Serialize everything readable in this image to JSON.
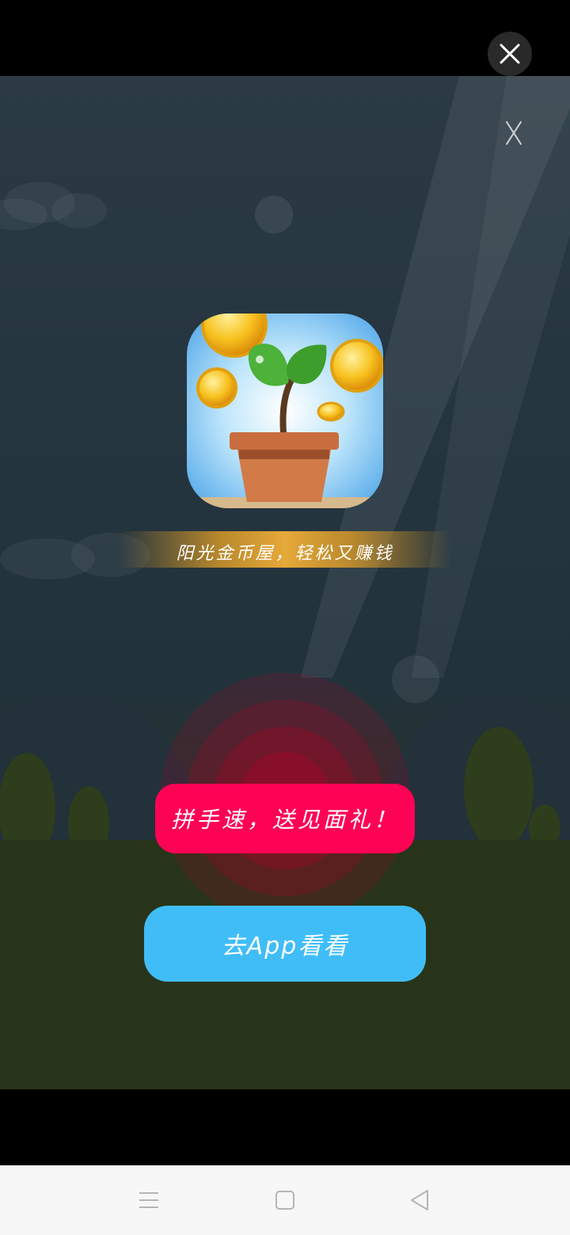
{
  "ad": {
    "slogan": "阳光金币屋，轻松又赚钱",
    "promo_label": "拼手速，送见面礼！",
    "cta_label": "去App看看",
    "app_icon": "plant-pot-coins-icon"
  },
  "icons": {
    "top_close": "close-icon",
    "ad_close": "close-icon",
    "nav_menu": "menu-icon",
    "nav_home": "home-square-icon",
    "nav_back": "back-triangle-icon"
  },
  "colors": {
    "promo_button": "#fd0356",
    "cta_button": "#40bdf7",
    "slogan_band": "#e6a93a",
    "navbar": "#f7f7f7"
  }
}
